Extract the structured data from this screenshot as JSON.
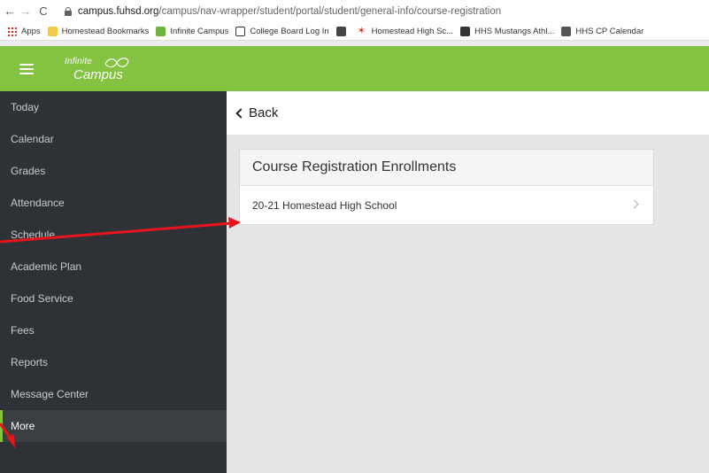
{
  "browser": {
    "url_domain": "campus.fuhsd.org",
    "url_path": "/campus/nav-wrapper/student/portal/student/general-info/course-registration",
    "bookmarks": [
      {
        "label": "Apps",
        "icon": "apps-icon"
      },
      {
        "label": "Homestead Bookmarks",
        "icon": "folder-icon"
      },
      {
        "label": "Infinite Campus",
        "icon": "infinite-campus-icon"
      },
      {
        "label": "College Board Log In",
        "icon": "college-board-icon"
      },
      {
        "label": "",
        "icon": "globe-icon"
      },
      {
        "label": "Homestead High Sc...",
        "icon": "homestead-icon"
      },
      {
        "label": "HHS Mustangs Athl...",
        "icon": "mustang-icon"
      },
      {
        "label": "HHS CP Calendar",
        "icon": "calendar-icon"
      }
    ]
  },
  "header": {
    "logo_top": "Infinite",
    "logo_bottom": "Campus",
    "accent_color": "#84c341"
  },
  "sidebar": {
    "items": [
      {
        "label": "Today"
      },
      {
        "label": "Calendar"
      },
      {
        "label": "Grades"
      },
      {
        "label": "Attendance"
      },
      {
        "label": "Schedule"
      },
      {
        "label": "Academic Plan"
      },
      {
        "label": "Food Service"
      },
      {
        "label": "Fees"
      },
      {
        "label": "Reports"
      },
      {
        "label": "Message Center"
      },
      {
        "label": "More"
      }
    ]
  },
  "main": {
    "back_label": "Back",
    "card_title": "Course Registration Enrollments",
    "rows": [
      {
        "label": "20-21 Homestead High School"
      }
    ]
  }
}
